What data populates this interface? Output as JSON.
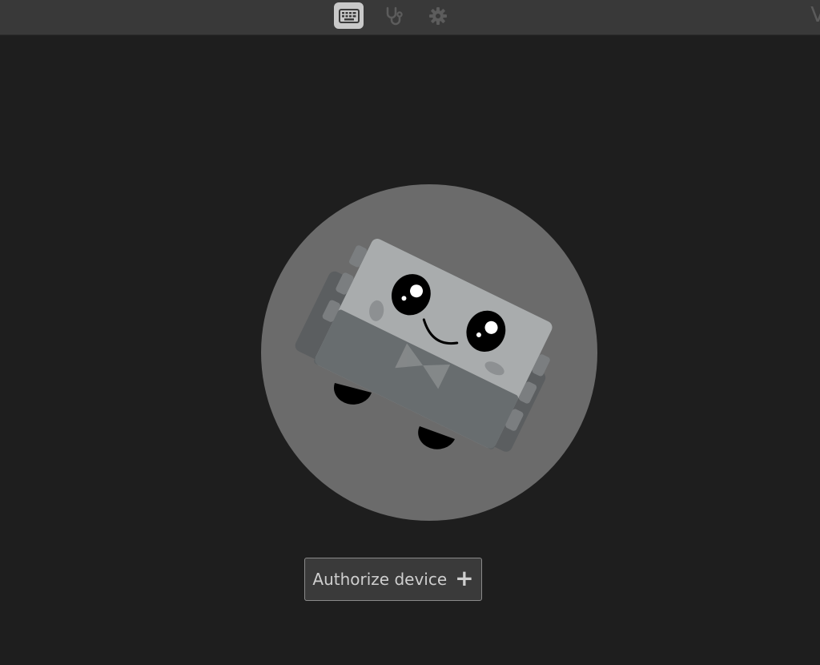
{
  "topbar": {
    "nav": [
      {
        "icon": "keyboard-icon",
        "active": true
      },
      {
        "icon": "stethoscope-icon",
        "active": false
      },
      {
        "icon": "gear-icon",
        "active": false
      }
    ],
    "brand_text": "V"
  },
  "main": {
    "illustration": "device-mascot",
    "authorize_label": "Authorize device",
    "authorize_icon": "plus-icon",
    "authorize_glyph": "+"
  },
  "colors": {
    "background": "#1e1e1e",
    "topbar": "#393939",
    "active_tab": "#c9c9c9",
    "circle": "#6b6b6b"
  }
}
